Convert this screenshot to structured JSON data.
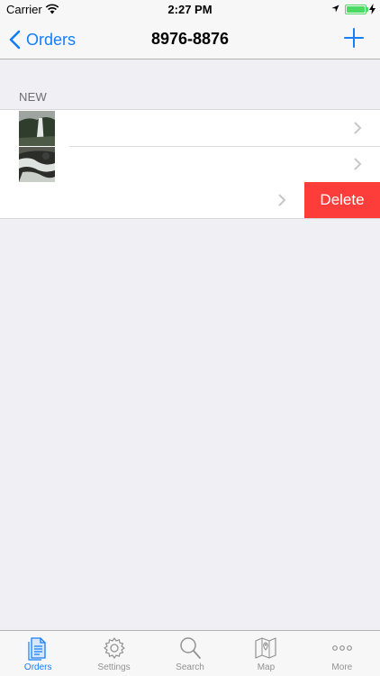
{
  "status_bar": {
    "carrier": "Carrier",
    "time": "2:27 PM"
  },
  "nav": {
    "back_label": "Orders",
    "title": "8976-8876"
  },
  "section": {
    "header": "NEW"
  },
  "list": {
    "rows": [
      {
        "thumbnail": "waterfall-photo"
      },
      {
        "thumbnail": "stream-rocks-photo"
      },
      {
        "thumbnail": "none"
      }
    ],
    "delete_label": "Delete"
  },
  "tabbar": {
    "tabs": [
      {
        "label": "Orders",
        "icon": "orders-icon",
        "active": true
      },
      {
        "label": "Settings",
        "icon": "gear-icon",
        "active": false
      },
      {
        "label": "Search",
        "icon": "search-icon",
        "active": false
      },
      {
        "label": "Map",
        "icon": "map-icon",
        "active": false
      },
      {
        "label": "More",
        "icon": "more-icon",
        "active": false
      }
    ]
  },
  "colors": {
    "accent": "#147efb",
    "delete": "#fc3d39",
    "battery": "#4cd964"
  }
}
